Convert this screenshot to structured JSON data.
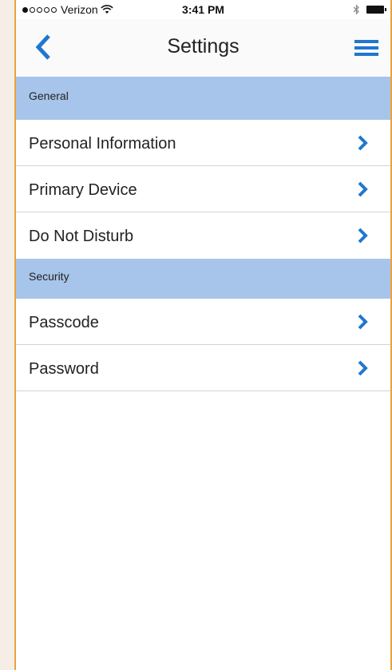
{
  "status_bar": {
    "carrier": "Verizon",
    "time": "3:41 PM",
    "signal_bars_filled": 1,
    "signal_bars_total": 5
  },
  "nav": {
    "title": "Settings",
    "back_icon": "chevron-left-icon",
    "menu_icon": "hamburger-menu-icon"
  },
  "colors": {
    "accent": "#1f77d0",
    "section_header_bg": "#a7c4ea",
    "frame_border": "#e9a23b"
  },
  "sections": [
    {
      "header": "General",
      "items": [
        {
          "label": "Personal Information"
        },
        {
          "label": "Primary Device"
        },
        {
          "label": "Do Not Disturb"
        }
      ]
    },
    {
      "header": "Security",
      "items": [
        {
          "label": "Passcode"
        },
        {
          "label": "Password"
        }
      ]
    }
  ]
}
